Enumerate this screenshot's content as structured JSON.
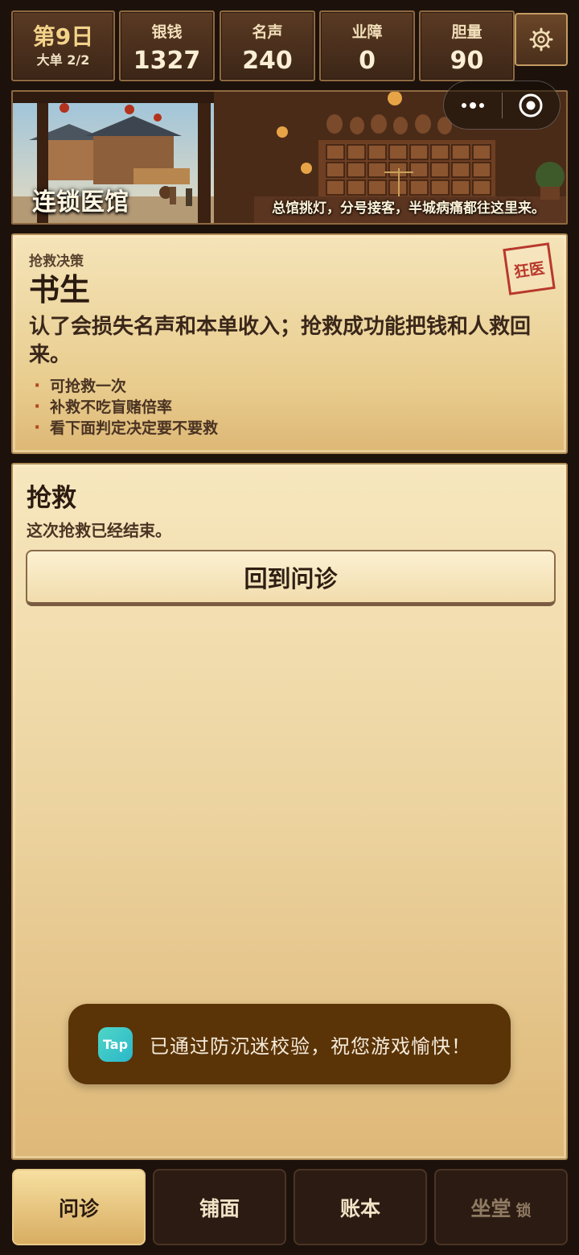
{
  "header": {
    "day": "第9日",
    "order": "大单 2/2",
    "stats": [
      {
        "label": "银钱",
        "value": "1327"
      },
      {
        "label": "名声",
        "value": "240"
      },
      {
        "label": "业障",
        "value": "0"
      },
      {
        "label": "胆量",
        "value": "90"
      }
    ],
    "settings_icon": "gear-icon"
  },
  "banner": {
    "title": "连锁医馆",
    "subtitle": "总馆挑灯，分号接客，半城病痛都往这里来。"
  },
  "mini_program_capsule": {
    "menu_icon": "more-dots-icon",
    "close_icon": "target-close-icon"
  },
  "decision": {
    "kicker": "抢救决策",
    "name": "书生",
    "stamp": "狂医",
    "description": "认了会损失名声和本单收入；抢救成功能把钱和人救回来。",
    "bullets": [
      "可抢救一次",
      "补救不吃盲赌倍率",
      "看下面判定决定要不要救"
    ]
  },
  "rescue": {
    "title": "抢救",
    "status": "这次抢救已经结束。",
    "back_button": "回到问诊"
  },
  "toast": {
    "logo_text": "Tap",
    "message": "已通过防沉迷校验，祝您游戏愉快！"
  },
  "tabs": [
    {
      "label": "问诊",
      "active": true
    },
    {
      "label": "铺面"
    },
    {
      "label": "账本"
    },
    {
      "label": "坐堂",
      "locked_label": "锁"
    }
  ],
  "colors": {
    "background": "#1d110b",
    "parchment": "#f5e4b9",
    "gold_accent": "#f3d38a",
    "stamp_red": "#b8382c",
    "toast_bg": "#5a3307"
  }
}
